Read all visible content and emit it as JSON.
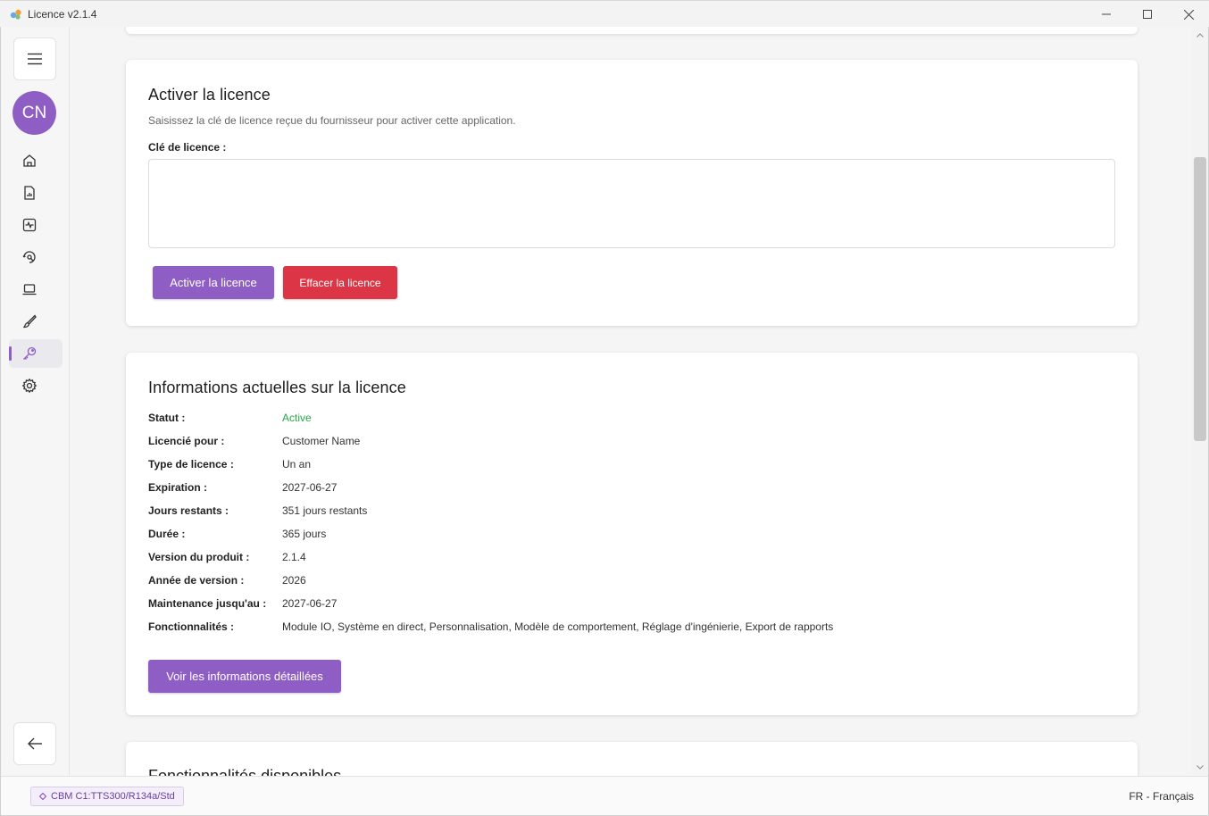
{
  "window": {
    "title": "Licence v2.1.4"
  },
  "sidebar": {
    "avatar_initials": "CN",
    "items": [
      {
        "icon": "home-icon"
      },
      {
        "icon": "report-icon"
      },
      {
        "icon": "activity-icon"
      },
      {
        "icon": "search-icon"
      },
      {
        "icon": "laptop-icon"
      },
      {
        "icon": "brush-icon"
      },
      {
        "icon": "key-icon",
        "active": true
      },
      {
        "icon": "gear-icon"
      }
    ]
  },
  "activate": {
    "title": "Activer la licence",
    "subtitle": "Saisissez la clé de licence reçue du fournisseur pour activer cette application.",
    "field_label": "Clé de licence :",
    "field_value": "",
    "activate_button": "Activer la licence",
    "clear_button": "Effacer la licence"
  },
  "info": {
    "title": "Informations actuelles sur la licence",
    "rows": [
      {
        "label": "Statut :",
        "value": "Active"
      },
      {
        "label": "Licencié pour :",
        "value": "Customer Name"
      },
      {
        "label": "Type de licence :",
        "value": "Un an"
      },
      {
        "label": "Expiration :",
        "value": "2027-06-27"
      },
      {
        "label": "Jours restants :",
        "value": "351 jours restants"
      },
      {
        "label": "Durée :",
        "value": "365 jours"
      },
      {
        "label": "Version du produit :",
        "value": "2.1.4"
      },
      {
        "label": "Année de version :",
        "value": "2026"
      },
      {
        "label": "Maintenance jusqu'au :",
        "value": "2027-06-27"
      },
      {
        "label": "Fonctionnalités :",
        "value": "Module IO, Système en direct, Personnalisation, Modèle de comportement, Réglage d'ingénierie, Export de rapports"
      }
    ],
    "details_button": "Voir les informations détaillées"
  },
  "features": {
    "title": "Fonctionnalités disponibles"
  },
  "statusbar": {
    "model": "CBM C1:TTS300/R134a/Std",
    "language": "FR - Français"
  },
  "colors": {
    "accent": "#8e5ec4",
    "danger": "#dc3545",
    "success": "#28a745"
  }
}
